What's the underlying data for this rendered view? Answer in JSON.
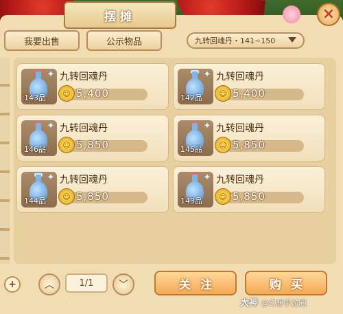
{
  "window": {
    "title": "摆摊",
    "close_label": "×"
  },
  "tabs": [
    {
      "label": "我要出售"
    },
    {
      "label": "公示物品"
    }
  ],
  "filter": {
    "selected": "九转回魂丹・141~150"
  },
  "items": [
    {
      "name": "九转回魂丹",
      "grade": "143品",
      "price": "5,400",
      "coin_glyph": "☺"
    },
    {
      "name": "九转回魂丹",
      "grade": "142品",
      "price": "5,400",
      "coin_glyph": "☺"
    },
    {
      "name": "九转回魂丹",
      "grade": "146品",
      "price": "5,850",
      "coin_glyph": "☺"
    },
    {
      "name": "九转回魂丹",
      "grade": "145品",
      "price": "5,850",
      "coin_glyph": "☺"
    },
    {
      "name": "九转回魂丹",
      "grade": "144品",
      "price": "5,850",
      "coin_glyph": "☺"
    },
    {
      "name": "九转回魂丹",
      "grade": "143品",
      "price": "5,850",
      "coin_glyph": "☺"
    }
  ],
  "pager": {
    "text": "1/1",
    "prev_glyph": "︿",
    "next_glyph": "﹀",
    "plus_glyph": "+"
  },
  "actions": {
    "follow_label": "关注",
    "buy_label": "购买"
  },
  "watermark": {
    "main": "大神",
    "sub": "@幻想手游圈"
  },
  "icons": {
    "close": "close-icon",
    "item": "potion-bottle-icon",
    "coin": "coin-icon",
    "dropdown": "chevron-down-icon"
  }
}
